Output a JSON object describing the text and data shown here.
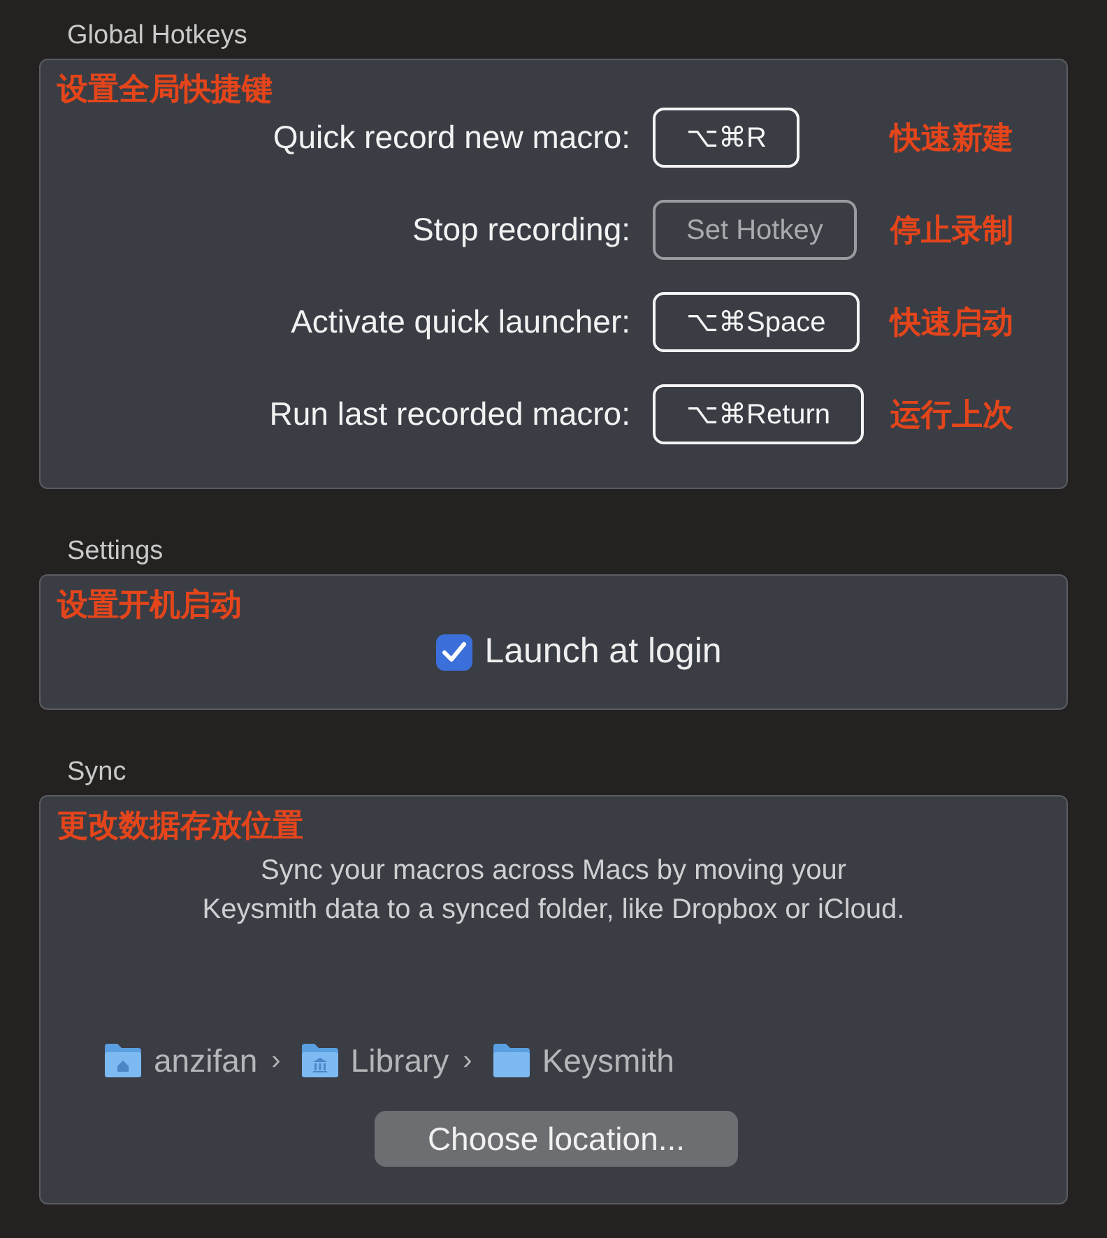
{
  "sections": [
    {
      "kind": "hotkeys",
      "title": "Global Hotkeys",
      "annotation": "设置全局快捷键",
      "rows": [
        {
          "label": "Quick record new macro:",
          "hotkey": "⌥⌘R",
          "set": true,
          "annotation": "快速新建"
        },
        {
          "label": "Stop recording:",
          "hotkey": "Set Hotkey",
          "set": false,
          "annotation": "停止录制"
        },
        {
          "label": "Activate quick launcher:",
          "hotkey": "⌥⌘Space",
          "set": true,
          "annotation": "快速启动"
        },
        {
          "label": "Run last recorded macro:",
          "hotkey": "⌥⌘Return",
          "set": true,
          "annotation": "运行上次"
        }
      ]
    },
    {
      "kind": "settings",
      "title": "Settings",
      "annotation": "设置开机启动",
      "checkbox": {
        "label": "Launch at login",
        "checked": true
      }
    },
    {
      "kind": "sync",
      "title": "Sync",
      "annotation": "更改数据存放位置",
      "description": [
        "Sync your macros across Macs by moving your",
        "Keysmith data to a synced folder, like Dropbox or iCloud."
      ],
      "path": [
        {
          "kind": "home",
          "label": "anzifan",
          "separator": "›"
        },
        {
          "kind": "library",
          "label": "Library",
          "separator": "›"
        },
        {
          "kind": "plain",
          "label": "Keysmith"
        }
      ],
      "button": "Choose location..."
    }
  ]
}
